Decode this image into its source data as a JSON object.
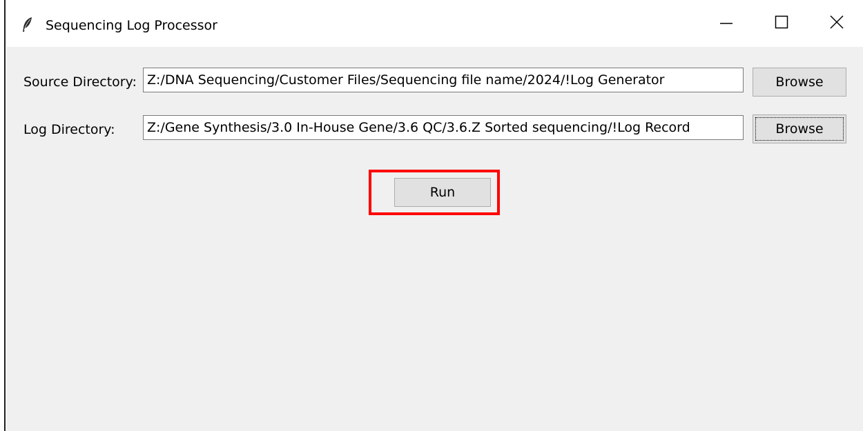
{
  "window": {
    "title": "Sequencing Log Processor",
    "icon": "feather-icon",
    "controls": {
      "minimize_icon": "minimize-icon",
      "maximize_icon": "maximize-icon",
      "close_icon": "close-icon"
    }
  },
  "form": {
    "source": {
      "label": "Source Directory:",
      "value": "Z:/DNA Sequencing/Customer Files/Sequencing file name/2024/!Log Generator",
      "browse_label": "Browse"
    },
    "log": {
      "label": "Log Directory:",
      "value": "Z:/Gene Synthesis/3.0 In-House Gene/3.6 QC/3.6.Z Sorted sequencing/!Log Record",
      "browse_label": "Browse"
    },
    "run_label": "Run"
  },
  "colors": {
    "background": "#f0f0f0",
    "titlebar": "#ffffff",
    "button": "#e1e1e1",
    "highlight": "#ff0000"
  }
}
